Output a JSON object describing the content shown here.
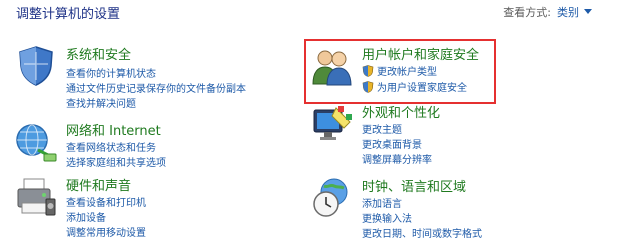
{
  "header": {
    "title": "调整计算机的设置",
    "view_by_label": "查看方式:",
    "view_by_value": "类别"
  },
  "categories": [
    {
      "title": "系统和安全",
      "links": [
        "查看你的计算机状态",
        "通过文件历史记录保存你的文件备份副本",
        "查找并解决问题"
      ]
    },
    {
      "title": "网络和 Internet",
      "links": [
        "查看网络状态和任务",
        "选择家庭组和共享选项"
      ]
    },
    {
      "title": "硬件和声音",
      "links": [
        "查看设备和打印机",
        "添加设备",
        "调整常用移动设置"
      ]
    },
    {
      "title": "用户帐户和家庭安全",
      "links": [
        "更改帐户类型",
        "为用户设置家庭安全"
      ]
    },
    {
      "title": "外观和个性化",
      "links": [
        "更改主题",
        "更改桌面背景",
        "调整屏幕分辨率"
      ]
    },
    {
      "title": "时钟、语言和区域",
      "links": [
        "添加语言",
        "更换输入法",
        "更改日期、时间或数字格式"
      ]
    }
  ],
  "colors": {
    "category_title": "#1f7a1f",
    "link": "#1e5aa8",
    "header": "#1e3287",
    "highlight_box": "#e53030"
  }
}
